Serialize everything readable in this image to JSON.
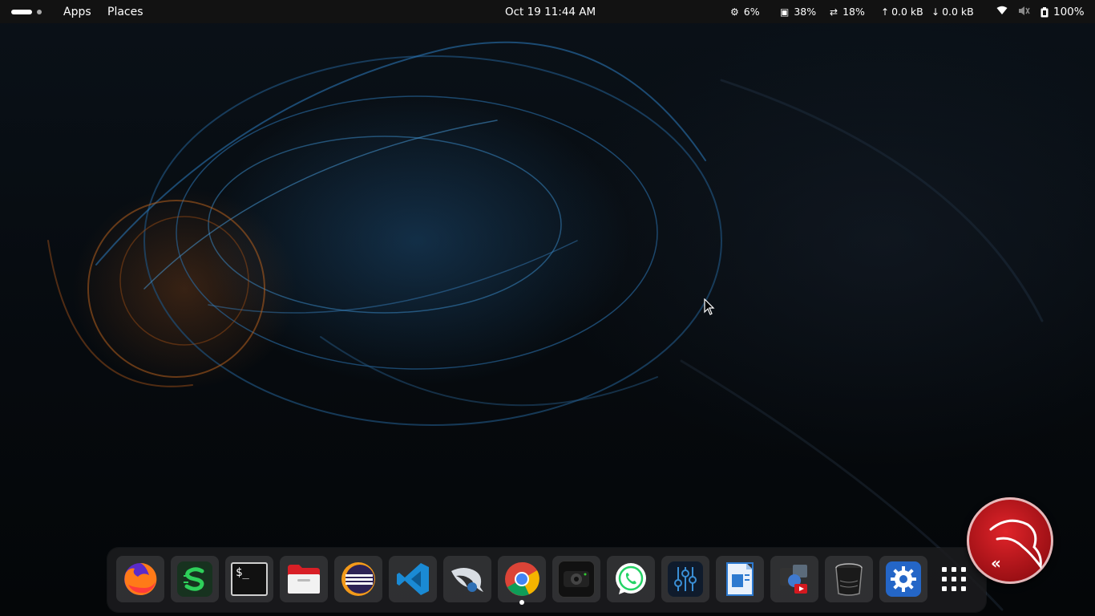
{
  "topbar": {
    "apps_label": "Apps",
    "places_label": "Places",
    "clock": "Oct 19  11:44 AM",
    "indicators": {
      "cpu": "6%",
      "memory": "38%",
      "swap": "18%",
      "upload": "0.0 kB",
      "download": "0.0 kB",
      "battery": "100%"
    },
    "icons": {
      "cpu": "cpu-icon",
      "memory": "memory-icon",
      "swap": "swap-icon",
      "upload": "upload-arrow-icon",
      "download": "download-arrow-icon",
      "wifi": "wifi-icon",
      "volume": "volume-muted-icon",
      "battery": "battery-icon"
    }
  },
  "dock": {
    "apps": [
      {
        "name": "firefox",
        "icon": "firefox-icon"
      },
      {
        "name": "gitkraken-style",
        "icon": "green-s-app-icon"
      },
      {
        "name": "terminal",
        "icon": "terminal-icon",
        "text": "$_"
      },
      {
        "name": "files",
        "icon": "file-manager-icon"
      },
      {
        "name": "eclipse",
        "icon": "eclipse-icon"
      },
      {
        "name": "vscode",
        "icon": "vscode-icon"
      },
      {
        "name": "kali-tools",
        "icon": "kali-dragon-icon"
      },
      {
        "name": "chrome",
        "icon": "chrome-icon",
        "running": true
      },
      {
        "name": "camera",
        "icon": "camera-icon"
      },
      {
        "name": "whatsapp",
        "icon": "whatsapp-icon"
      },
      {
        "name": "settings-tweaks",
        "icon": "sliders-icon"
      },
      {
        "name": "writer",
        "icon": "document-writer-icon"
      },
      {
        "name": "media-apps",
        "icon": "media-apps-icon"
      },
      {
        "name": "trash",
        "icon": "trash-icon"
      },
      {
        "name": "settings",
        "icon": "gear-icon"
      }
    ],
    "show_apps_icon": "app-grid-icon"
  },
  "colors": {
    "topbar_bg": "#121212",
    "kali_red": "#d4181f",
    "vscode_blue": "#1a8ad4",
    "whatsapp_green": "#ffffff"
  }
}
